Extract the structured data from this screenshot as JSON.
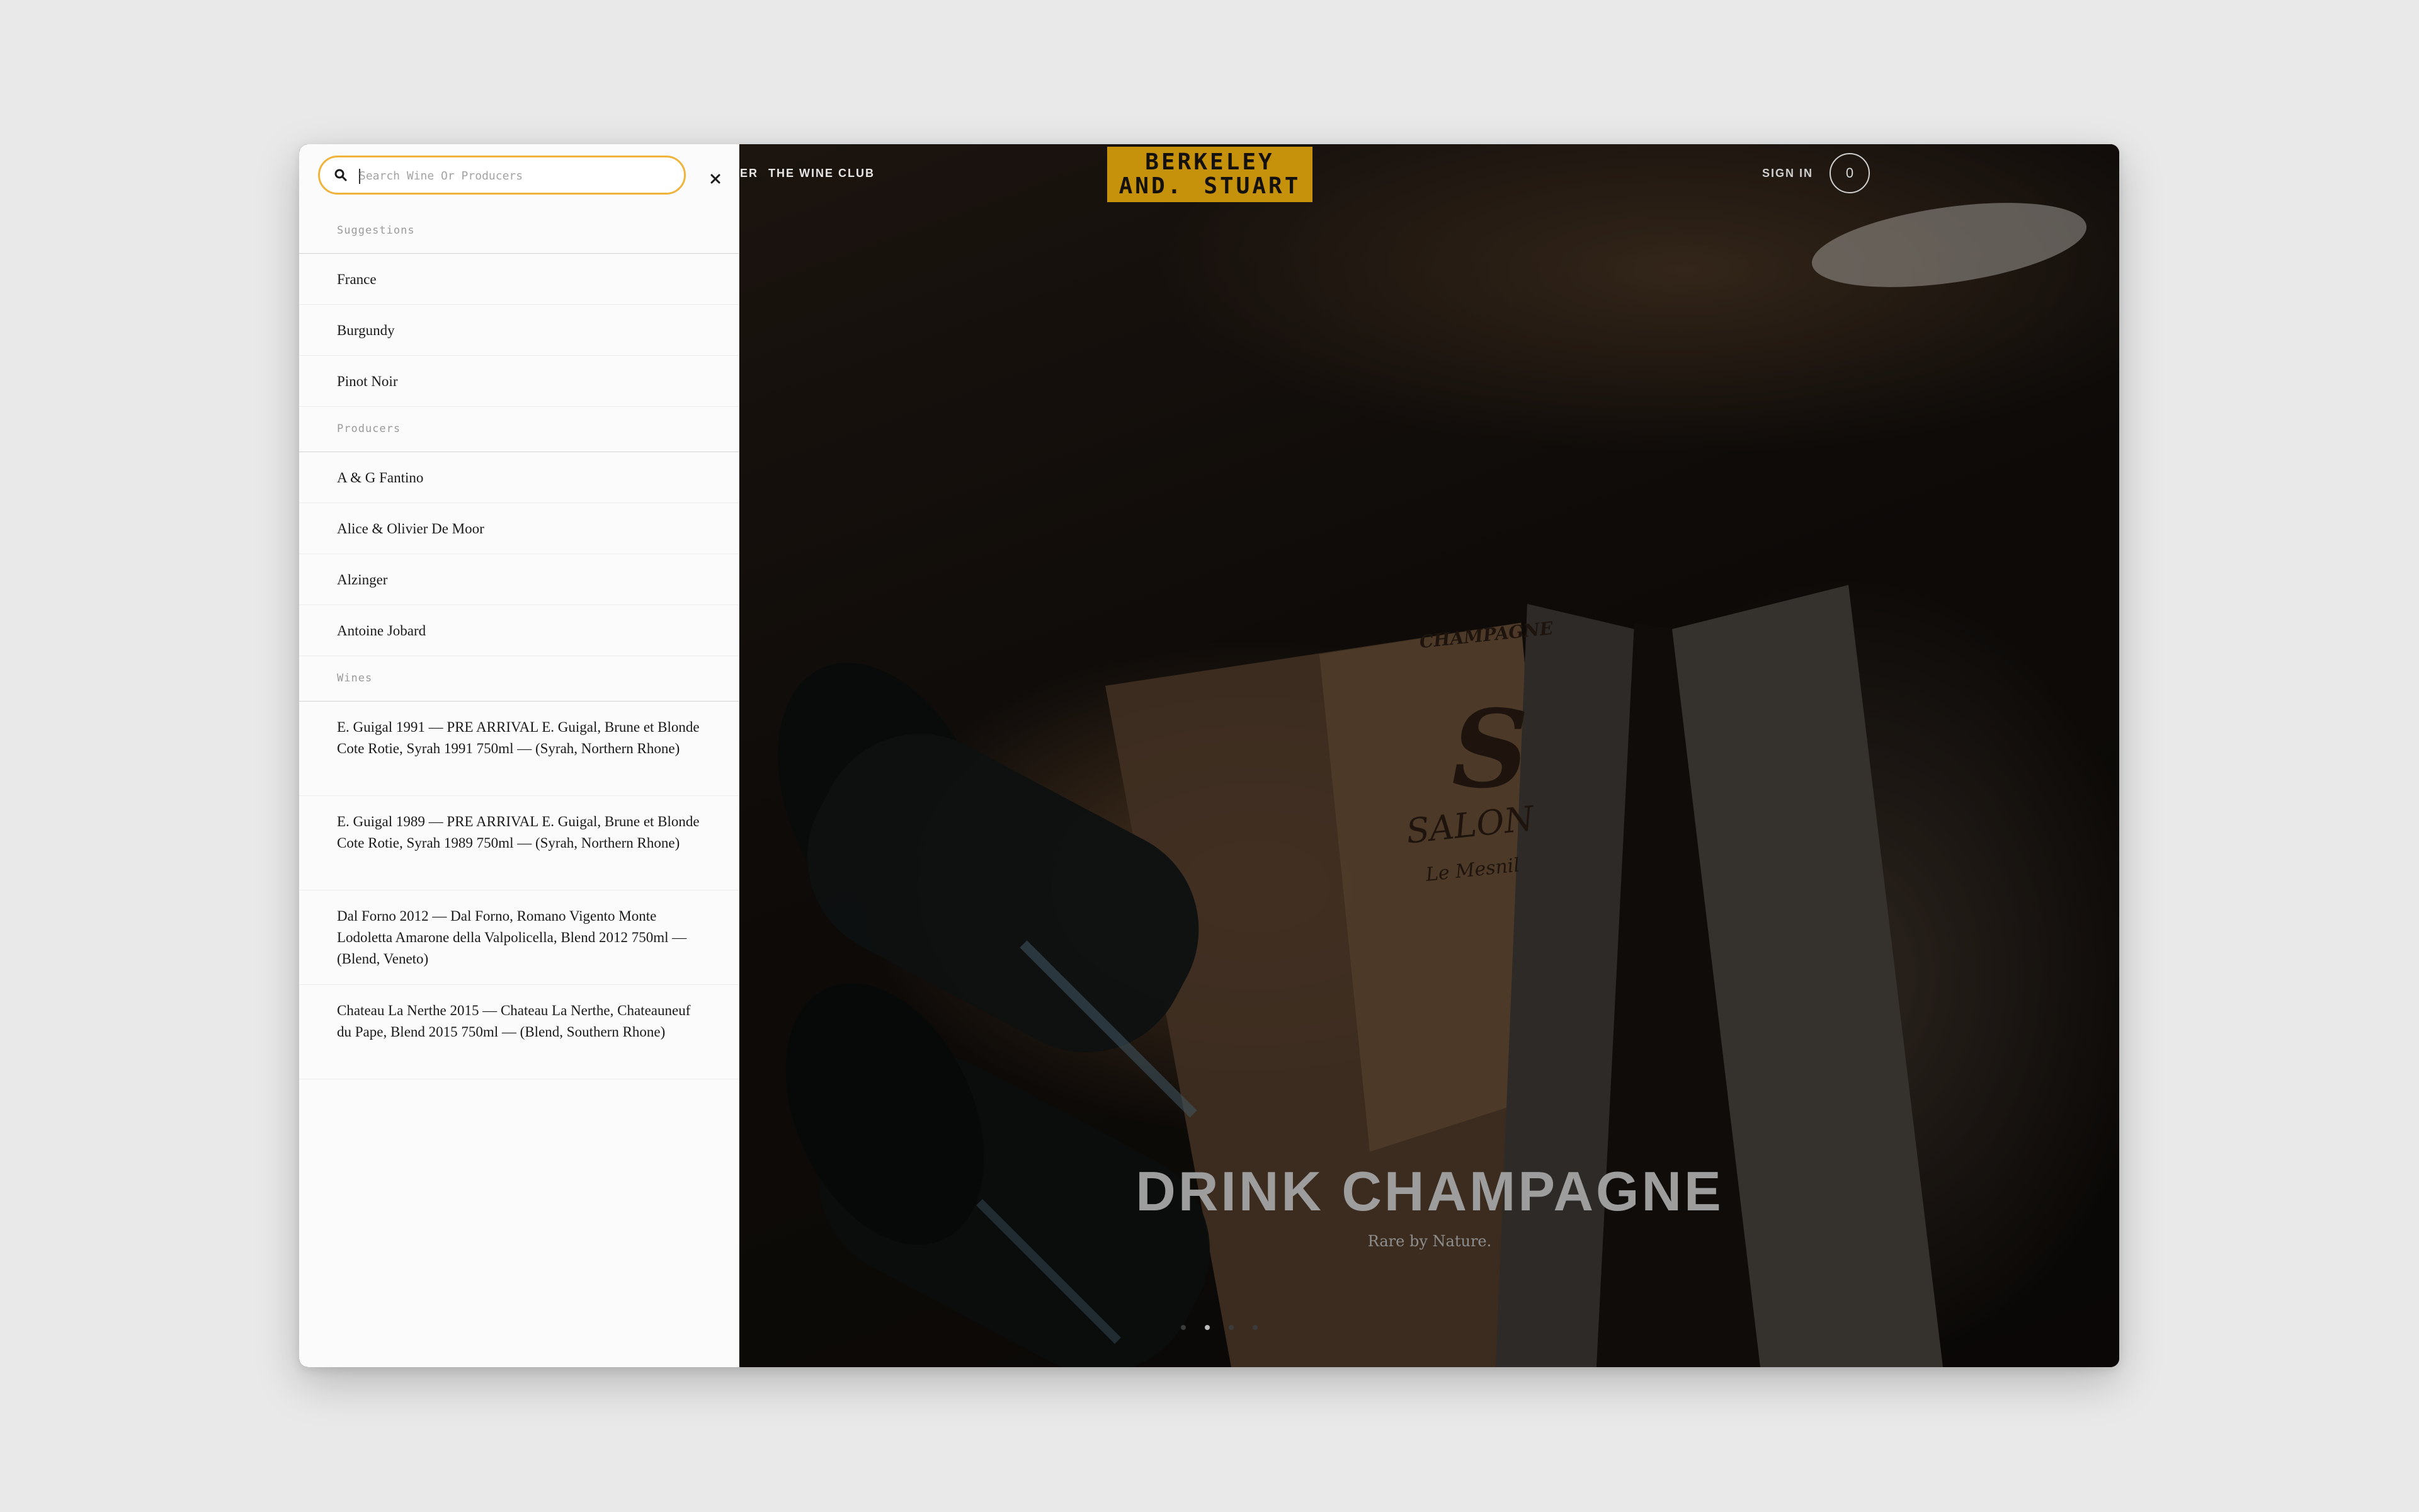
{
  "nav": {
    "partial_link": "ER",
    "wine_club": "THE WINE CLUB",
    "sign_in": "SIGN IN",
    "cart_count": "0"
  },
  "logo": {
    "line1": "BERKELEY",
    "line2_left": "AND.",
    "line2_right": "STUART",
    "color": "#c6920b"
  },
  "hero": {
    "title": "DRINK CHAMPAGNE",
    "subtitle": "Rare by Nature.",
    "crate_text_1": "CHAMPAGNE",
    "crate_text_2": "SALON",
    "crate_text_3": "Le Mesnil",
    "slides": 4,
    "active_slide": 2
  },
  "search": {
    "placeholder": "Search Wine Or Producers",
    "value": "",
    "accent": "#f0b43c",
    "icons": {
      "search": "search-icon",
      "close": "close-icon"
    }
  },
  "sections": {
    "suggestions": "Suggestions",
    "producers": "Producers",
    "wines": "Wines"
  },
  "suggestions": [
    "France",
    "Burgundy",
    "Pinot Noir"
  ],
  "producers": [
    "A & G Fantino",
    "Alice & Olivier De Moor",
    "Alzinger",
    "Antoine Jobard"
  ],
  "wines": [
    "E. Guigal 1991 — PRE ARRIVAL E. Guigal, Brune et Blonde Cote Rotie, Syrah 1991 750ml — (Syrah, Northern Rhone)",
    "E. Guigal 1989 — PRE ARRIVAL E. Guigal, Brune et Blonde Cote Rotie, Syrah 1989 750ml — (Syrah, Northern Rhone)",
    "Dal Forno 2012 — Dal Forno, Romano Vigento Monte Lodoletta Amarone della Valpolicella, Blend 2012 750ml — (Blend, Veneto)",
    "Chateau La Nerthe 2015 — Chateau La Nerthe, Chateauneuf du Pape, Blend 2015 750ml — (Blend, Southern Rhone)"
  ]
}
